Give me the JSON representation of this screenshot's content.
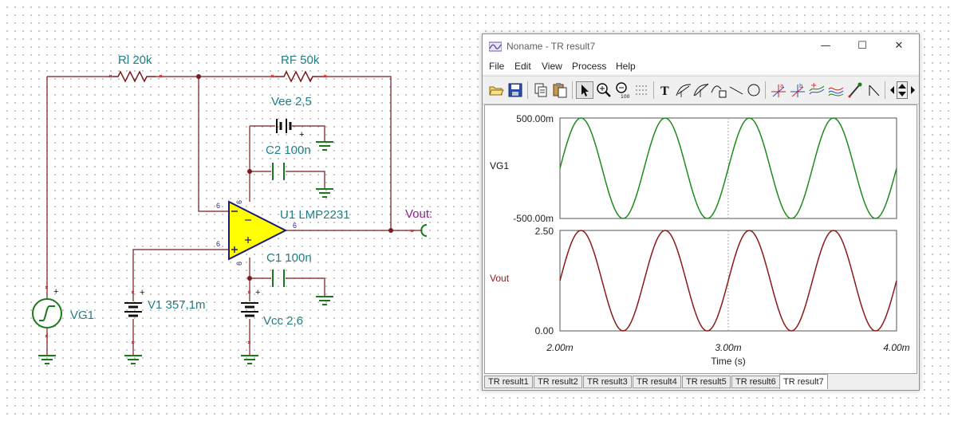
{
  "schematic": {
    "components": {
      "rl": "Rl 20k",
      "rf": "RF 50k",
      "vee": "Vee 2,5",
      "c2": "C2 100n",
      "opamp": "U1 LMP2231",
      "vout": "Vout:",
      "c1": "C1 100n",
      "v1": "V1 357,1m",
      "vg1": "VG1",
      "vcc": "Vcc 2,6"
    },
    "pins": {
      "p1": "6",
      "p2": "6",
      "p3": "6",
      "p4": "6",
      "p5": "6",
      "p6": "6"
    },
    "colors": {
      "wire": "#7a1a1a",
      "label": "#1f7f86",
      "opamp_fill": "#ffff00",
      "opamp_edge": "#1a1a7a",
      "vout_label": "#8b1f8b"
    }
  },
  "window": {
    "title": "Noname - TR result7",
    "controls": {
      "minimize": "—",
      "maximize": "☐",
      "close": "✕"
    },
    "menu": [
      "File",
      "Edit",
      "View",
      "Process",
      "Help"
    ],
    "toolbar_icons": [
      "open-icon",
      "save-icon",
      "copy-icon",
      "paste-icon",
      "cursor-icon",
      "zoom-in-icon",
      "zoom-out-icon",
      "grid-icon",
      "text-icon",
      "tangent-icon",
      "slope-icon",
      "line-tool-icon",
      "line-icon",
      "circle-icon",
      "cursor-a-icon",
      "cursor-b-icon",
      "wave-icon",
      "add-curve-icon",
      "probe-icon",
      "marker-icon",
      "scroll-left-icon",
      "scroll-updown-icon",
      "scroll-right-icon"
    ],
    "tabs": [
      "TR result1",
      "TR result2",
      "TR result3",
      "TR result4",
      "TR result5",
      "TR result6",
      "TR result7"
    ],
    "active_tab": "TR result7"
  },
  "chart_data": [
    {
      "type": "line",
      "ylabel": "VG1",
      "ylim": [
        -0.5,
        0.5
      ],
      "yticks": [
        "500.00m",
        "-500.00m"
      ],
      "xlim": [
        0.002,
        0.004
      ],
      "series": [
        {
          "name": "VG1",
          "color": "#1e8c1e",
          "amplitude": 0.5,
          "offset": 0,
          "frequency_hz": 2000,
          "x": [
            0.002,
            0.00225,
            0.0025,
            0.00275,
            0.003,
            0.00325,
            0.0035,
            0.00375,
            0.004
          ],
          "y": [
            0,
            0.5,
            0,
            -0.5,
            0,
            0.5,
            0,
            -0.5,
            0
          ]
        }
      ]
    },
    {
      "type": "line",
      "ylabel": "Vout",
      "xlabel": "Time (s)",
      "ylim": [
        0,
        2.5
      ],
      "yticks": [
        "2.50",
        "0.00"
      ],
      "xlim": [
        0.002,
        0.004
      ],
      "xticks": [
        "2.00m",
        "3.00m",
        "4.00m"
      ],
      "series": [
        {
          "name": "Vout",
          "color": "#8b1a1a",
          "amplitude": 1.25,
          "offset": 1.25,
          "frequency_hz": 2000,
          "x": [
            0.002,
            0.00225,
            0.0025,
            0.00275,
            0.003,
            0.00325,
            0.0035,
            0.00375,
            0.004
          ],
          "y": [
            1.25,
            0,
            1.25,
            2.5,
            1.25,
            0,
            1.25,
            2.5,
            1.25
          ]
        }
      ]
    }
  ]
}
